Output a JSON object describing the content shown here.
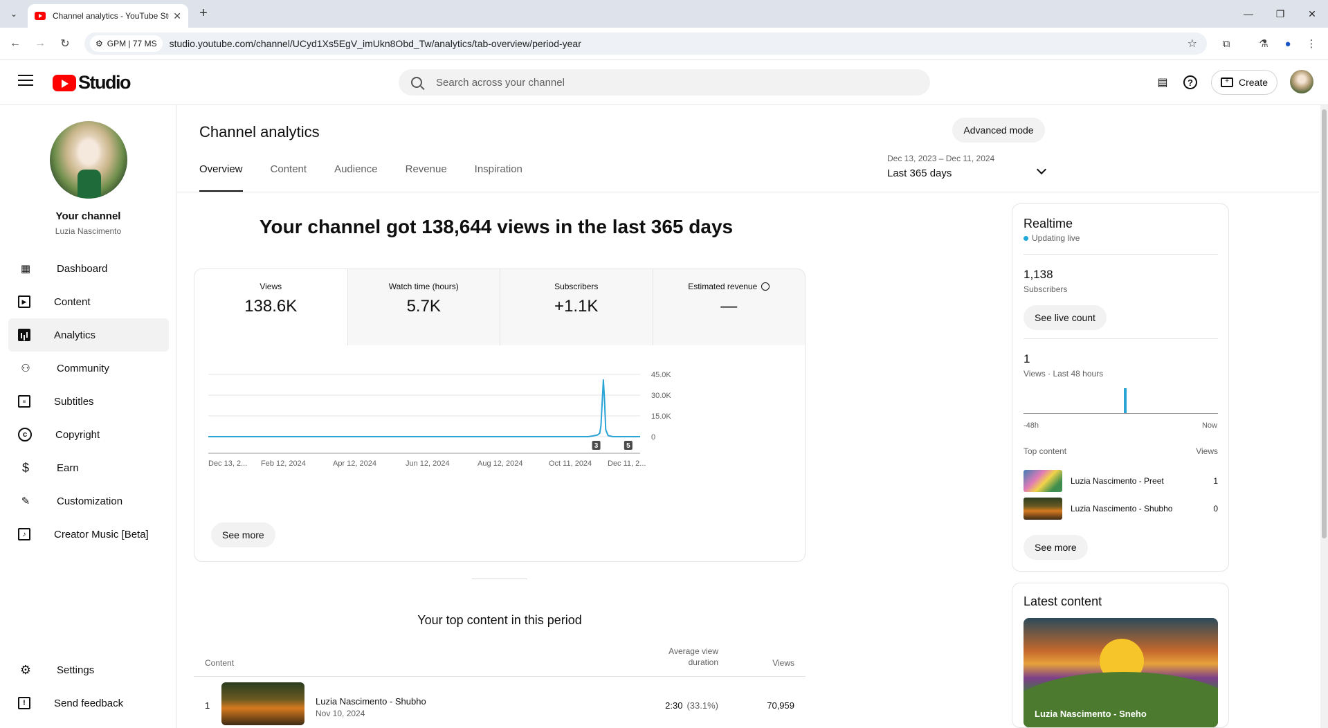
{
  "browser": {
    "tab_title": "Channel analytics - YouTube Studio",
    "url": "studio.youtube.com/channel/UCyd1Xs5EgV_imUkn8Obd_Tw/analytics/tab-overview/period-year",
    "site_chip": "GPM | 77 MS"
  },
  "header": {
    "logo_text": "Studio",
    "search_placeholder": "Search across your channel",
    "create_label": "Create"
  },
  "sidebar": {
    "channel_title": "Your channel",
    "channel_name": "Luzia Nascimento",
    "items": [
      {
        "label": "Dashboard",
        "icon": "dashboard-icon"
      },
      {
        "label": "Content",
        "icon": "content-icon"
      },
      {
        "label": "Analytics",
        "icon": "analytics-icon"
      },
      {
        "label": "Community",
        "icon": "community-icon"
      },
      {
        "label": "Subtitles",
        "icon": "subtitles-icon"
      },
      {
        "label": "Copyright",
        "icon": "copyright-icon"
      },
      {
        "label": "Earn",
        "icon": "earn-icon"
      },
      {
        "label": "Customization",
        "icon": "customization-icon"
      },
      {
        "label": "Creator Music [Beta]",
        "icon": "creator-music-icon"
      }
    ],
    "bottom_items": [
      {
        "label": "Settings",
        "icon": "gear-icon"
      },
      {
        "label": "Send feedback",
        "icon": "feedback-icon"
      }
    ]
  },
  "main": {
    "title": "Channel analytics",
    "advanced_mode": "Advanced mode",
    "tabs": [
      "Overview",
      "Content",
      "Audience",
      "Revenue",
      "Inspiration"
    ],
    "period_range": "Dec 13, 2023 – Dec 11, 2024",
    "period_label": "Last 365 days",
    "headline": "Your channel got 138,644 views in the last 365 days",
    "metrics": [
      {
        "label": "Views",
        "value": "138.6K"
      },
      {
        "label": "Watch time (hours)",
        "value": "5.7K"
      },
      {
        "label": "Subscribers",
        "value": "+1.1K"
      },
      {
        "label": "Estimated revenue",
        "value": "—"
      }
    ],
    "see_more": "See more",
    "top_content_title": "Your top content in this period",
    "table_headers": {
      "content": "Content",
      "avd_line1": "Average view",
      "avd_line2": "duration",
      "views": "Views"
    },
    "top_rows": [
      {
        "index": "1",
        "title": "Luzia Nascimento - Shubho",
        "date": "Nov 10, 2024",
        "avd": "2:30",
        "avd_pct": "(33.1%)",
        "views": "70,959"
      }
    ]
  },
  "chart_data": {
    "type": "line",
    "x_tick_labels": [
      "Dec 13, 2...",
      "Feb 12, 2024",
      "Apr 12, 2024",
      "Jun 12, 2024",
      "Aug 12, 2024",
      "Oct 11, 2024",
      "Dec 11, 2..."
    ],
    "y_tick_labels": [
      "45.0K",
      "30.0K",
      "15.0K",
      "0"
    ],
    "ylim": [
      0,
      45000
    ],
    "series": [
      {
        "x": [
          "2023-12-13",
          "2024-10-28",
          "2024-11-01",
          "2024-11-05",
          "2024-11-07",
          "2024-11-08",
          "2024-11-09",
          "2024-11-10",
          "2024-11-11",
          "2024-11-12",
          "2024-11-14",
          "2024-11-18",
          "2024-12-11"
        ],
        "values": [
          0,
          0,
          500,
          1200,
          2500,
          8000,
          24000,
          41000,
          26000,
          5000,
          800,
          0,
          0
        ],
        "color": "#2aa3d5"
      }
    ],
    "annotations": [
      {
        "label": "3",
        "x": "2024-11-04"
      },
      {
        "label": "5",
        "x": "2024-12-01"
      }
    ],
    "grid": true
  },
  "realtime": {
    "title": "Realtime",
    "status": "Updating live",
    "subs_value": "1,138",
    "subs_label": "Subscribers",
    "live_count_btn": "See live count",
    "views_value": "1",
    "views_label": "Views · Last 48 hours",
    "axis_left": "-48h",
    "axis_right": "Now",
    "spike_fraction": 1.0,
    "top_content_label": "Top content",
    "top_content_views": "Views",
    "rows": [
      {
        "title": "Luzia Nascimento - Preet",
        "views": "1"
      },
      {
        "title": "Luzia Nascimento - Shubho",
        "views": "0"
      }
    ],
    "see_more": "See more"
  },
  "latest": {
    "title": "Latest content",
    "video_title": "Luzia Nascimento - Sneho"
  },
  "colors": {
    "accent": "#2aa3d5",
    "youtube_red": "#ff0000"
  }
}
